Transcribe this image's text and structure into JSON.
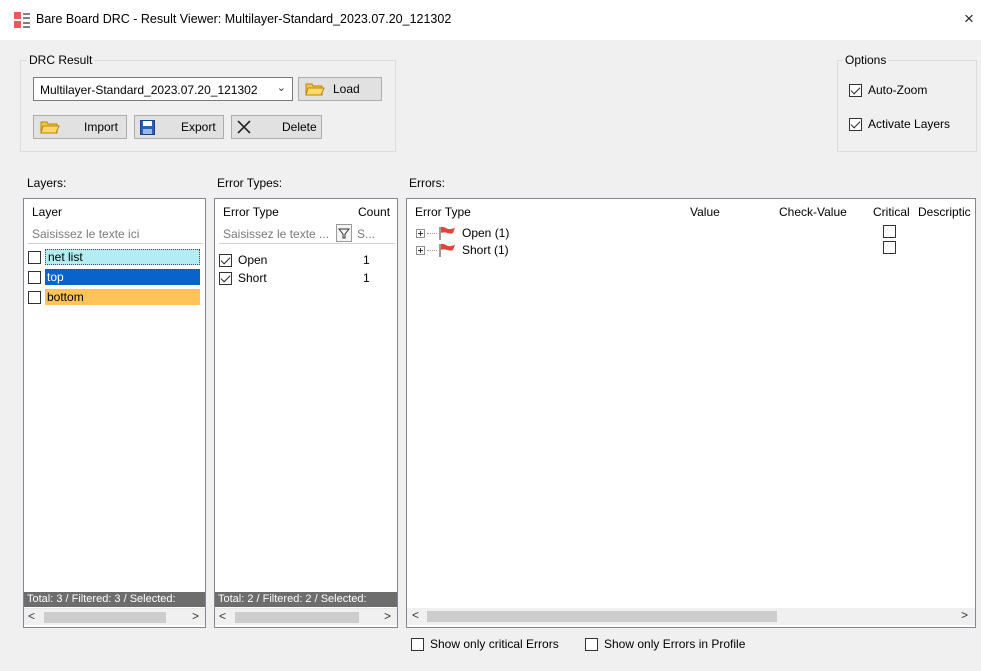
{
  "window": {
    "title": "Bare Board DRC - Result Viewer: Multilayer-Standard_2023.07.20_121302",
    "close_glyph": "×"
  },
  "drc_result": {
    "group_label": "DRC Result",
    "selected_result": "Multilayer-Standard_2023.07.20_121302",
    "load_label": "Load",
    "import_label": "Import",
    "export_label": "Export",
    "delete_label": "Delete"
  },
  "options": {
    "group_label": "Options",
    "auto_zoom": {
      "label": "Auto-Zoom",
      "checked": true
    },
    "activate_layers": {
      "label": "Activate Layers",
      "checked": true
    }
  },
  "layers": {
    "section_label": "Layers:",
    "column": "Layer",
    "filter_placeholder": "Saisissez le texte ici",
    "items": [
      {
        "label": "net list",
        "color": "#b3ecf2",
        "checked": false
      },
      {
        "label": "top",
        "color": "#0a63c9",
        "checked": false
      },
      {
        "label": "bottom",
        "color": "#ffc35a",
        "checked": false
      }
    ],
    "status": "Total: 3 / Filtered: 3 / Selected:"
  },
  "error_types": {
    "section_label": "Error Types:",
    "columns": {
      "type": "Error Type",
      "count": "Count"
    },
    "filter_placeholder": "Saisissez le texte ...",
    "count_filter_placeholder": "S...",
    "items": [
      {
        "label": "Open",
        "count": "1",
        "checked": true
      },
      {
        "label": "Short",
        "count": "1",
        "checked": true
      }
    ],
    "status": "Total: 2 / Filtered: 2 / Selected:"
  },
  "errors": {
    "section_label": "Errors:",
    "columns": [
      "Error Type",
      "Value",
      "Check-Value",
      "Critical",
      "Descriptic"
    ],
    "rows": [
      {
        "label": "Open (1)",
        "critical": false
      },
      {
        "label": "Short (1)",
        "critical": false
      }
    ]
  },
  "footer": {
    "show_critical_label": "Show only critical Errors",
    "show_profile_label": "Show only Errors in Profile"
  },
  "colors": {
    "flag_red": "#e0453a",
    "selection_blue": "#0a63c9"
  },
  "icons": [
    "app-icon",
    "folder-open-icon",
    "save-disk-icon",
    "delete-x-icon",
    "filter-funnel-icon",
    "red-flag-icon",
    "close-icon"
  ]
}
